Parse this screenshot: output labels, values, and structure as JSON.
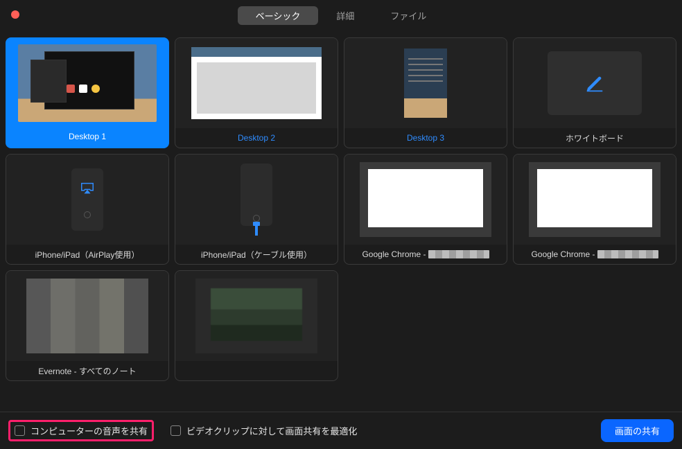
{
  "tabs": {
    "basic": "ベーシック",
    "advanced": "詳細",
    "files": "ファイル"
  },
  "tiles": [
    {
      "label": "Desktop 1"
    },
    {
      "label": "Desktop 2"
    },
    {
      "label": "Desktop 3"
    },
    {
      "label": "ホワイトボード"
    },
    {
      "label": "iPhone/iPad（AirPlay使用）"
    },
    {
      "label": "iPhone/iPad（ケーブル使用）"
    },
    {
      "label_prefix": "Google Chrome - "
    },
    {
      "label_prefix": "Google Chrome - "
    },
    {
      "label": "Evernote - すべてのノート"
    },
    {
      "label": ""
    }
  ],
  "footer": {
    "share_audio": "コンピューターの音声を共有",
    "optimize_video": "ビデオクリップに対して画面共有を最適化",
    "share_button": "画面の共有"
  },
  "colors": {
    "accent": "#0a84ff",
    "highlight": "#ff1f6b"
  }
}
